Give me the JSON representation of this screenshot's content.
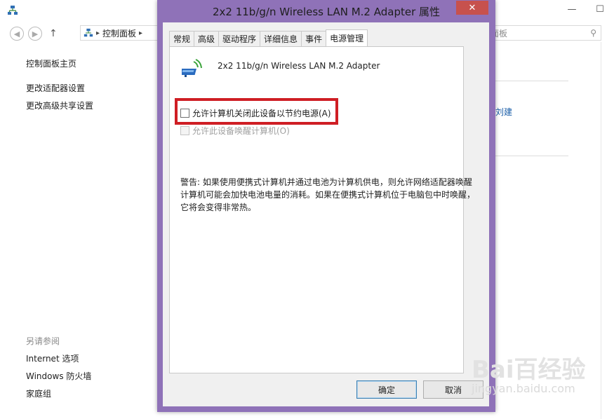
{
  "background": {
    "address": "控制面板",
    "search_placeholder": "面板",
    "left_nav": [
      "控制面板主页",
      "更改适配器设置",
      "更改高级共享设置"
    ],
    "see_also_title": "另请参阅",
    "see_also": [
      "Internet 选项",
      "Windows 防火墙",
      "家庭组"
    ],
    "right_link": "刘建"
  },
  "dialog": {
    "title": "2x2 11b/g/n Wireless LAN M.2 Adapter 属性",
    "tabs": [
      "常规",
      "高级",
      "驱动程序",
      "详细信息",
      "事件",
      "电源管理"
    ],
    "active_tab": "电源管理",
    "device_name": "2x2 11b/g/n Wireless LAN M.2 Adapter",
    "checkbox_allow_off": "允许计算机关闭此设备以节约电源(A)",
    "checkbox_allow_wake": "允许此设备唤醒计算机(O)",
    "warning": "警告: 如果使用便携式计算机并通过电池为计算机供电，则允许网络适配器唤醒计算机可能会加快电池电量的消耗。如果在便携式计算机位于电脑包中时唤醒，它将会变得非常热。",
    "ok_label": "确定",
    "cancel_label": "取消"
  },
  "watermark": {
    "main": "Bai百经验",
    "sub": "jingyan.baidu.com"
  },
  "colors": {
    "dialog_frame": "#8f72b8",
    "close_button": "#c7514d",
    "highlight_box": "#cf1e24",
    "link": "#1a5ea8"
  }
}
